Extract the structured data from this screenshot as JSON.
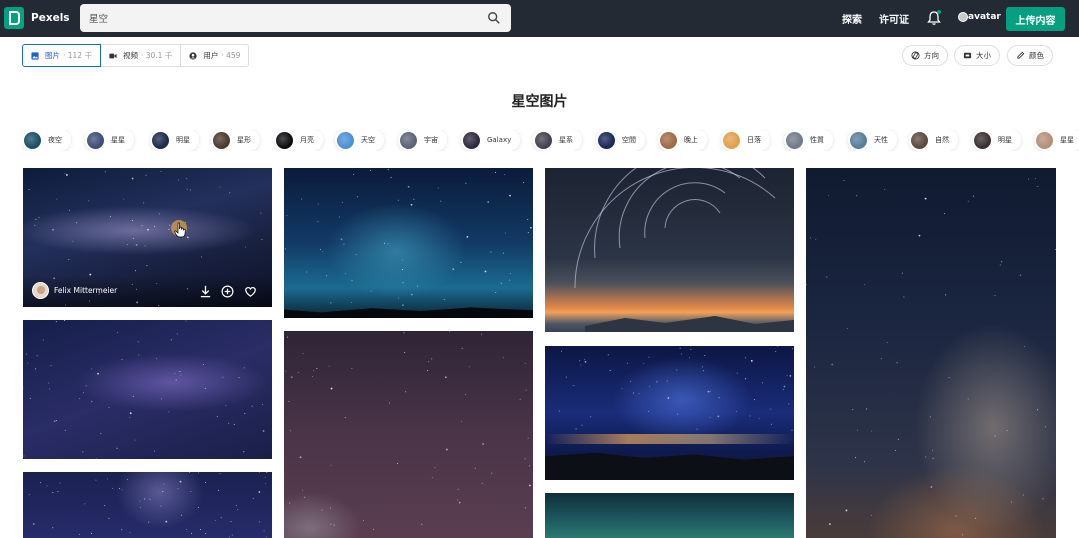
{
  "header": {
    "logo_text": "Pexels",
    "search_value": "星空",
    "nav": {
      "explore": "探索",
      "license": "许可证"
    },
    "avatar_label": "avatar",
    "upload_label": "上传内容",
    "brand_color": "#05a081"
  },
  "tabs": [
    {
      "label": "图片",
      "count": "· 112 千",
      "icon": "image-icon",
      "active": true
    },
    {
      "label": "视频",
      "count": "· 30.1 千",
      "icon": "video-icon",
      "active": false
    },
    {
      "label": "用户",
      "count": "· 459",
      "icon": "user-icon",
      "active": false
    }
  ],
  "filters": [
    {
      "label": "方向",
      "icon": "orientation-icon"
    },
    {
      "label": "大小",
      "icon": "size-icon"
    },
    {
      "label": "颜色",
      "icon": "color-icon"
    }
  ],
  "page_title": "星空图片",
  "chips": [
    {
      "label": "夜空",
      "color": "#1a4f66"
    },
    {
      "label": "星星",
      "color": "#3e4f78"
    },
    {
      "label": "明星",
      "color": "#1d2c4c"
    },
    {
      "label": "星形",
      "color": "#4b3a2e"
    },
    {
      "label": "月亮",
      "color": "#0e0e12"
    },
    {
      "label": "天空",
      "color": "#4d8fd6"
    },
    {
      "label": "宇宙",
      "color": "#5c6478"
    },
    {
      "label": "Galaxy",
      "color": "#2e2a3e"
    },
    {
      "label": "星系",
      "color": "#45424f"
    },
    {
      "label": "空間",
      "color": "#1b2858"
    },
    {
      "label": "晚上",
      "color": "#a06a46"
    },
    {
      "label": "日落",
      "color": "#e2a04e"
    },
    {
      "label": "性質",
      "color": "#707a88"
    },
    {
      "label": "天性",
      "color": "#5a7c9a"
    },
    {
      "label": "自然",
      "color": "#5c4a40"
    },
    {
      "label": "明星",
      "color": "#3a3030"
    },
    {
      "label": "星星",
      "color": "#b49078"
    }
  ],
  "featured_photo": {
    "photographer": "Felix Mittermeier",
    "actions": [
      "download-icon",
      "add-collection-icon",
      "like-icon"
    ]
  }
}
